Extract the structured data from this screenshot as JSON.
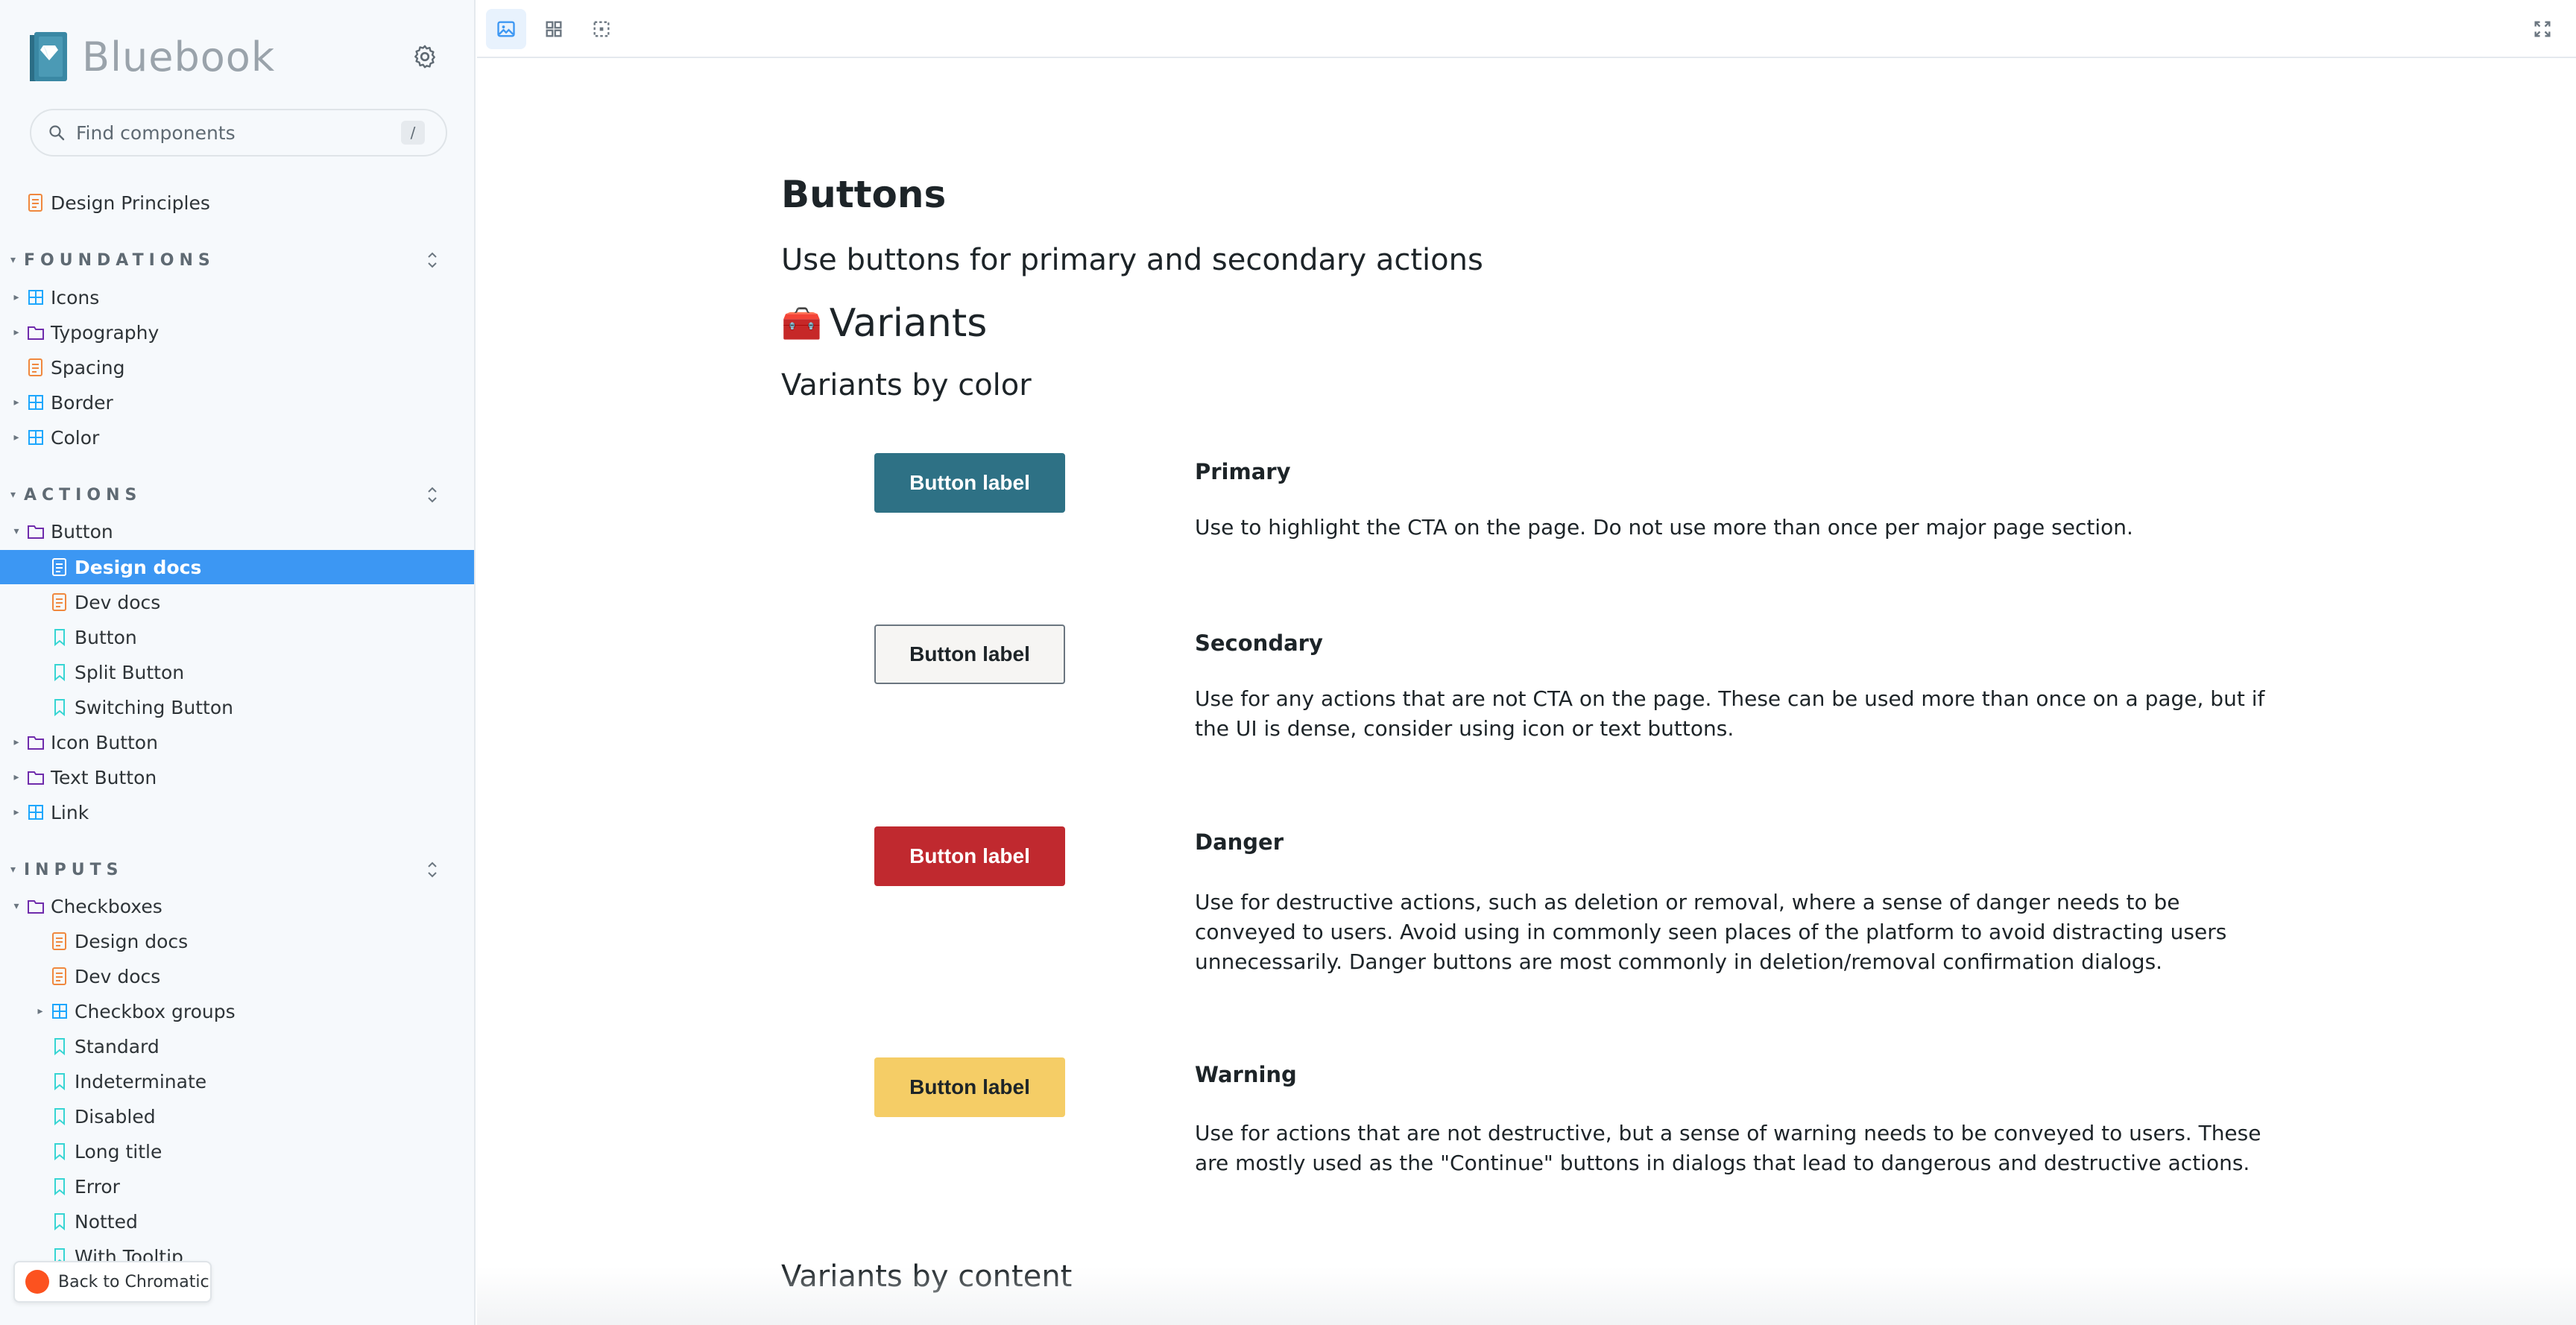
{
  "app": {
    "name": "Bluebook"
  },
  "search": {
    "placeholder": "Find components",
    "shortcut": "/"
  },
  "tree": {
    "top": [
      {
        "label": "Design Principles"
      }
    ],
    "foundations": {
      "title": "FOUNDATIONS",
      "items": [
        {
          "label": "Icons"
        },
        {
          "label": "Typography"
        },
        {
          "label": "Spacing"
        },
        {
          "label": "Border"
        },
        {
          "label": "Color"
        }
      ]
    },
    "actions": {
      "title": "ACTIONS",
      "items": [
        {
          "label": "Button"
        },
        {
          "label": "Design docs"
        },
        {
          "label": "Dev docs"
        },
        {
          "label": "Button"
        },
        {
          "label": "Split Button"
        },
        {
          "label": "Switching Button"
        },
        {
          "label": "Icon Button"
        },
        {
          "label": "Text Button"
        },
        {
          "label": "Link"
        }
      ]
    },
    "inputs": {
      "title": "INPUTS",
      "items": [
        {
          "label": "Checkboxes"
        },
        {
          "label": "Design docs"
        },
        {
          "label": "Dev docs"
        },
        {
          "label": "Checkbox groups"
        },
        {
          "label": "Standard"
        },
        {
          "label": "Indeterminate"
        },
        {
          "label": "Disabled"
        },
        {
          "label": "Long title"
        },
        {
          "label": "Error"
        },
        {
          "label": "Notted"
        },
        {
          "label": "With Tooltip"
        }
      ]
    }
  },
  "chromatic": {
    "label": "Back to Chromatic"
  },
  "doc": {
    "title": "Buttons",
    "subtitle": "Use buttons for primary and secondary actions",
    "section_emoji": "🧰",
    "section_title": "Variants",
    "by_color": "Variants by color",
    "by_content": "Variants by content",
    "variants": [
      {
        "button": "Button label",
        "title": "Primary",
        "desc": "Use to highlight the CTA on the page. Do not use more than once per major page section.",
        "bg": "#2e7185",
        "fg": "#ffffff"
      },
      {
        "button": "Button label",
        "title": "Secondary",
        "desc": "Use for any actions that are not CTA on the page. These can be used more than once on a page, but if the UI is dense, consider using icon or text buttons.",
        "bg": "#f6f5f3",
        "fg": "#1d2428"
      },
      {
        "button": "Button label",
        "title": "Danger",
        "desc": "Use for destructive actions, such as deletion or removal, where a sense of danger needs to be conveyed to users. Avoid using in commonly seen places of the platform to avoid distracting users unnecessarily. Danger buttons are most commonly in deletion/removal confirmation dialogs.",
        "bg": "#c0292f",
        "fg": "#ffffff"
      },
      {
        "button": "Button label",
        "title": "Warning",
        "desc": "Use for actions that are not destructive, but a sense of warning needs to be conveyed to users. These are mostly used as the \"Continue\" buttons in dialogs that lead to dangerous and destructive actions.",
        "bg": "#f5cd66",
        "fg": "#1d2428"
      }
    ]
  },
  "colors": {
    "accent": "#3c97f3",
    "doc_icon": "#f0883e",
    "component_icon": "#1ea7fd",
    "folder_icon": "#6f2cac",
    "story_icon": "#37d5d3"
  }
}
